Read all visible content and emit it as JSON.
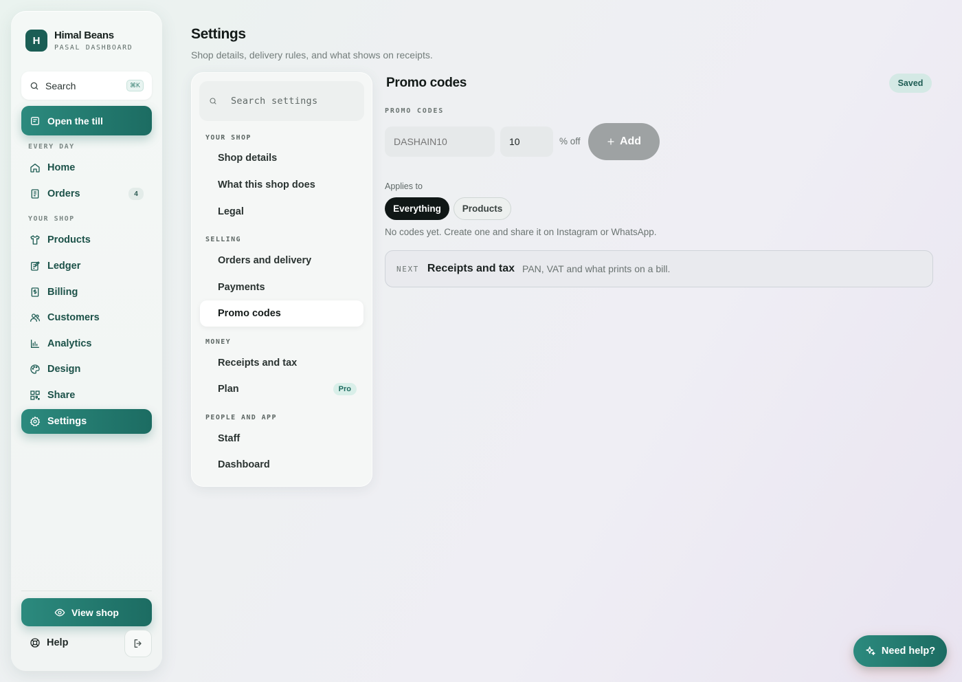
{
  "brand": {
    "logo_letter": "H",
    "name": "Himal Beans",
    "subtitle": "PASAL DASHBOARD"
  },
  "sidebar": {
    "search_label": "Search",
    "search_shortcut": "⌘K",
    "till_label": "Open the till",
    "sections": [
      "EVERY DAY",
      "YOUR SHOP"
    ],
    "items": [
      {
        "label": "Home",
        "icon": "home-icon"
      },
      {
        "label": "Orders",
        "icon": "receipt-icon",
        "count": "4"
      },
      {
        "label": "Products",
        "icon": "shirt-icon"
      },
      {
        "label": "Ledger",
        "icon": "ledger-icon"
      },
      {
        "label": "Billing",
        "icon": "bill-icon"
      },
      {
        "label": "Customers",
        "icon": "users-icon"
      },
      {
        "label": "Analytics",
        "icon": "bar-chart-icon"
      },
      {
        "label": "Design",
        "icon": "palette-icon"
      },
      {
        "label": "Share",
        "icon": "qr-code-icon"
      },
      {
        "label": "Settings",
        "icon": "gear-icon",
        "active": true
      }
    ],
    "view_shop_label": "View shop",
    "help_label": "Help"
  },
  "header": {
    "title": "Settings",
    "subtitle": "Shop details, delivery rules, and what shows on receipts."
  },
  "settings_nav": {
    "search_placeholder": "Search settings",
    "sections": [
      {
        "label": "YOUR SHOP",
        "items": [
          "Shop details",
          "What this shop does",
          "Legal"
        ]
      },
      {
        "label": "SELLING",
        "items": [
          "Orders and delivery",
          "Payments",
          "Promo codes"
        ]
      },
      {
        "label": "MONEY",
        "items": [
          "Receipts and tax",
          "Plan"
        ]
      },
      {
        "label": "PEOPLE AND APP",
        "items": [
          "Staff",
          "Dashboard"
        ]
      }
    ],
    "active_item": "Promo codes",
    "plan_badge": "Pro"
  },
  "promo": {
    "title": "Promo codes",
    "status": "Saved",
    "field_label": "PROMO CODES",
    "code_placeholder": "DASHAIN10",
    "percent_value": "10",
    "percent_suffix": "% off",
    "add_label": "Add",
    "applies_label": "Applies to",
    "scope_options": [
      "Everything",
      "Products"
    ],
    "scope_selected": "Everything",
    "empty_text": "No codes yet. Create one and share it on Instagram or WhatsApp."
  },
  "next_card": {
    "tag": "NEXT",
    "title": "Receipts and tax",
    "description": "PAN, VAT and what prints on a bill."
  },
  "help_fab": {
    "label": "Need help?"
  },
  "colors": {
    "accent": "#1c6c62",
    "accent_light": "#2c8a7e",
    "dark_pill": "#101716",
    "saved_badge": "#d4e9e5"
  }
}
